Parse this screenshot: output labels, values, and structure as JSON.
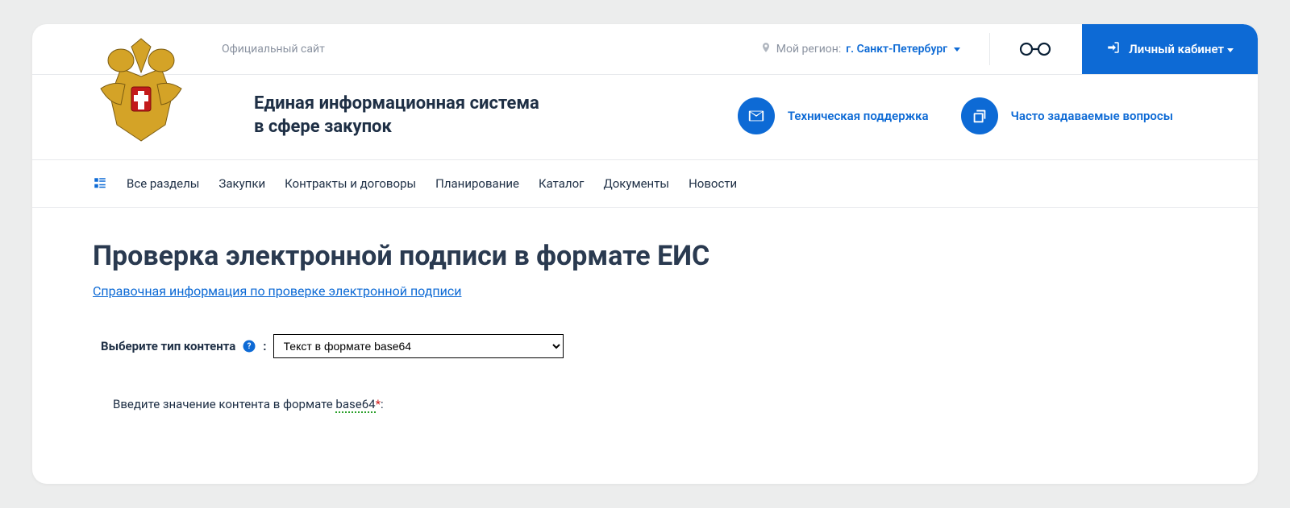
{
  "topbar": {
    "official": "Официальный сайт",
    "region_label": "Мой регион:",
    "region_value": "г. Санкт-Петербург",
    "account_label": "Личный кабинет"
  },
  "header": {
    "site_title_line1": "Единая информационная система",
    "site_title_line2": "в сфере закупок",
    "tech_support": "Техническая поддержка",
    "faq": "Часто задаваемые вопросы"
  },
  "nav": {
    "all_sections": "Все разделы",
    "items": [
      "Закупки",
      "Контракты и договоры",
      "Планирование",
      "Каталог",
      "Документы",
      "Новости"
    ]
  },
  "page": {
    "title": "Проверка электронной подписи в формате ЕИС",
    "help_link": "Справочная информация по проверке электронной подписи",
    "content_type_label": "Выберите тип контента",
    "content_type_selected": "Текст в формате base64",
    "content_value_prefix": "Введите значение контента в формате ",
    "content_value_fmt": "base64",
    "required_mark": "*",
    "content_value_suffix": ":"
  }
}
